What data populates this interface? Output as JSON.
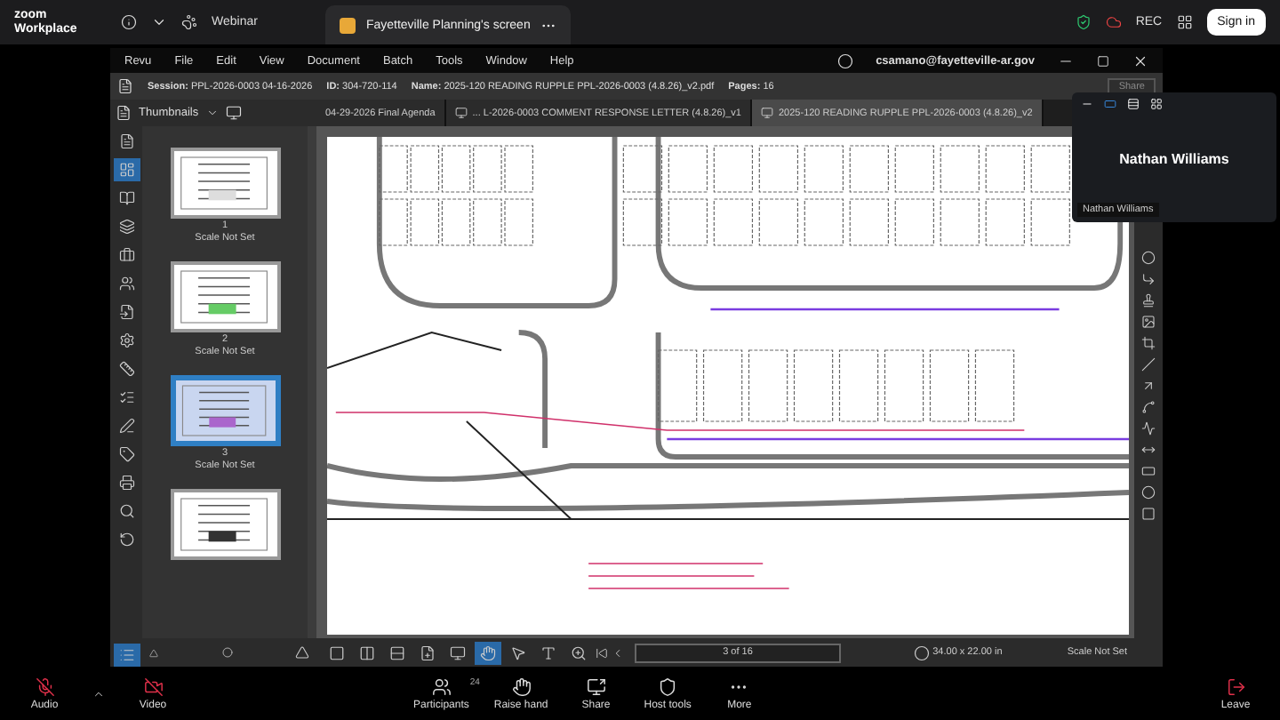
{
  "zoom_bar": {
    "logo": [
      "zoom",
      "Workplace"
    ],
    "webinar": "Webinar",
    "share_tab": "Fayetteville Planning's screen",
    "rec": "REC",
    "sign_in": "Sign in"
  },
  "revu": {
    "menu": [
      "Revu",
      "File",
      "Edit",
      "View",
      "Document",
      "Batch",
      "Tools",
      "Window",
      "Help"
    ],
    "account": "csamano@fayetteville-ar.gov",
    "session": [
      {
        "label": "Session:",
        "value": "PPL-2026-0003 04-16-2026"
      },
      {
        "label": "ID:",
        "value": "304-720-114"
      },
      {
        "label": "Name:",
        "value": "2025-120 READING RUPPLE PPL-2026-0003 (4.8.26)_v2.pdf"
      },
      {
        "label": "Pages:",
        "value": "16"
      }
    ],
    "share": "Share",
    "tabs": [
      {
        "label": "04-29-2026 Final Agenda",
        "selected": false,
        "kind": "plain"
      },
      {
        "label": "... L-2026-0003 COMMENT RESPONSE LETTER (4.8.26)_v1",
        "selected": false,
        "kind": "doc"
      },
      {
        "label": "2025-120 READING RUPPLE PPL-2026-0003 (4.8.26)_v2",
        "selected": true,
        "kind": "doc"
      }
    ],
    "side_tools": [
      {
        "selected": false
      },
      {
        "selected": true
      },
      {
        "selected": false
      },
      {
        "selected": false
      },
      {
        "selected": false
      },
      {
        "selected": false
      },
      {
        "selected": false
      },
      {
        "selected": false
      },
      {
        "selected": false
      },
      {
        "selected": false
      },
      {
        "selected": false
      },
      {
        "selected": false
      },
      {
        "selected": false
      },
      {
        "selected": false
      },
      {
        "selected": false
      }
    ],
    "thumbnails": {
      "title": "Thumbnails",
      "pages": [
        {
          "number": "1",
          "label": "Scale Not Set",
          "selected": false
        },
        {
          "number": "2",
          "label": "Scale Not Set",
          "selected": false
        },
        {
          "number": "3",
          "label": "Scale Not Set",
          "selected": true
        },
        {
          "selected": false
        }
      ]
    },
    "nav_tools": [
      {
        "selected": false
      },
      {
        "selected": false
      },
      {
        "selected": false
      },
      {
        "selected": false
      },
      {
        "selected": false
      },
      {
        "selected": true
      },
      {
        "selected": false
      },
      {
        "selected": false
      },
      {
        "selected": false
      }
    ],
    "status": {
      "page": "3 of 16",
      "size": "34.00 x 22.00 in",
      "scale": "Scale Not Set"
    }
  },
  "video_panel": {
    "name": "Nathan Williams",
    "label": "Nathan Williams"
  },
  "meeting_bar": {
    "audio": {
      "label": "Audio",
      "muted": true
    },
    "video": {
      "label": "Video",
      "off": true
    },
    "items": [
      {
        "kind": "participants",
        "label": "Participants",
        "count": "24"
      },
      {
        "kind": "raise_hand",
        "label": "Raise hand"
      },
      {
        "kind": "share",
        "label": "Share"
      },
      {
        "kind": "host_tools",
        "label": "Host tools"
      },
      {
        "kind": "more",
        "label": "More"
      }
    ],
    "leave": "Leave"
  }
}
